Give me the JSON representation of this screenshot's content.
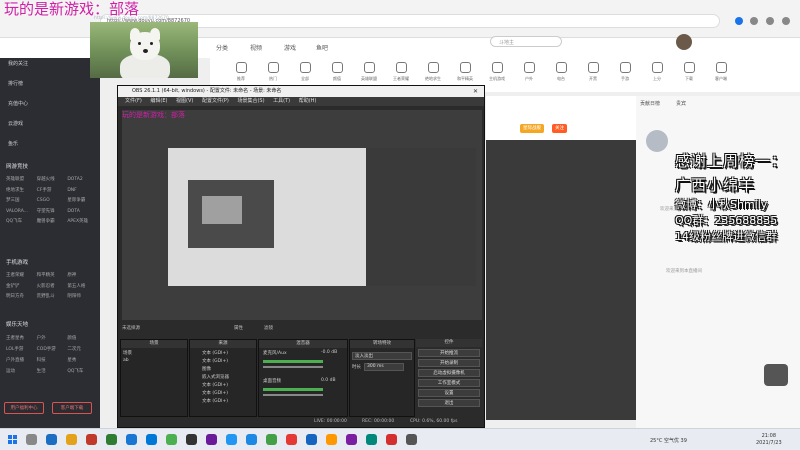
{
  "overlay_title": "玩的是新游戏：部落",
  "browser": {
    "url": "https://www.douyu.com/8872670"
  },
  "header": {
    "nav": [
      "分类",
      "视频",
      "游戏",
      "鱼吧"
    ],
    "search_placeholder": "斗地主"
  },
  "categories": [
    "推荐",
    "热门",
    "全部",
    "颜值",
    "英雄联盟",
    "王者荣耀",
    "绝地求生",
    "和平精英",
    "主机游戏",
    "户外",
    "电台",
    "开黑",
    "手游",
    "上分",
    "下载",
    "客户端"
  ],
  "sidebar": {
    "top_items": [
      "我的关注",
      "排行榜",
      "充值中心",
      "云游戏",
      "鱼乐"
    ],
    "section1": "网游竞技",
    "section1_items": [
      "英雄联盟",
      "穿越火线",
      "DOTA2",
      "绝地求生",
      "CF手游",
      "DNF",
      "梦三国",
      "CSGO",
      "星际争霸",
      "VALORA...",
      "守望先锋",
      "DOTA",
      "QQ飞车",
      "魔兽争霸",
      "APEX英雄"
    ],
    "section2": "手机游戏",
    "section2_items": [
      "王者荣耀",
      "和平精英",
      "原神",
      "金铲铲",
      "火影忍者",
      "第五人格",
      "明日方舟",
      "荒野乱斗",
      "阴阳师"
    ],
    "section3": "娱乐天地",
    "section3_items": [
      "王者星秀",
      "户外",
      "颜值",
      "LOL手游",
      "COD手游",
      "二次元",
      "户外直播",
      "科技",
      "星秀",
      "运动",
      "生活",
      "QQ飞车"
    ],
    "btn_left": "用户福利中心",
    "btn_right": "客户端下载"
  },
  "dog_url": "https://www.douyu.com/8872670",
  "obs": {
    "title": "OBS 26.1.1 (64-bit, windows) - 配置文件: 未命名 - 场景: 未命名",
    "menu": [
      "文件(F)",
      "编辑(E)",
      "视图(V)",
      "配置文件(P)",
      "场景集合(S)",
      "工具(T)",
      "帮助(H)"
    ],
    "no_source": "未选择源",
    "properties": "属性",
    "filters": "滤镜",
    "panels": {
      "scenes": "场景",
      "sources": "来源",
      "mixer": "混音器",
      "transitions": "转场特效",
      "controls": "控件"
    },
    "scenes_list": [
      "场景",
      "ab"
    ],
    "sources_list": [
      "文本 (GDI+)",
      "文本 (GDI+)",
      "图像",
      "嵌入式浏览器",
      "文本 (GDI+)",
      "文本 (GDI+)",
      "文本 (GDI+)"
    ],
    "mixer": {
      "ch1": "麦克风/Aux",
      "ch1_db": "-0.0 dB",
      "ch2": "桌面音频",
      "ch2_db": "0.0 dB"
    },
    "transition": {
      "type": "淡入淡出",
      "duration_label": "时长",
      "duration": "300 ms"
    },
    "controls": [
      "开始推流",
      "开始录制",
      "启动虚拟摄像机",
      "工作室模式",
      "设置",
      "退出"
    ],
    "status": {
      "live": "LIVE: 00:00:00",
      "rec": "REC: 00:00:00",
      "cpu": "CPU: 0.6%, 60.00 fps"
    }
  },
  "room": {
    "title": "直播间名称",
    "chips": [
      "星际战舰",
      "关注"
    ]
  },
  "right": {
    "tabs": [
      "贡献日榜",
      "贵宾"
    ],
    "sub1": "感谢上周榜一：",
    "sub2": "广西小绵羊",
    "sub3": "微博：小秋Shmily",
    "sub4": "QQ群：235688835",
    "sub5": "14级粉丝牌进微信群",
    "chat1": "欢迎来到本直播间",
    "chat2": "欢迎来到本直播间"
  },
  "taskbar": {
    "weather": "25°C 空气优 39",
    "time": "21:08",
    "date": "2021/7/23"
  }
}
